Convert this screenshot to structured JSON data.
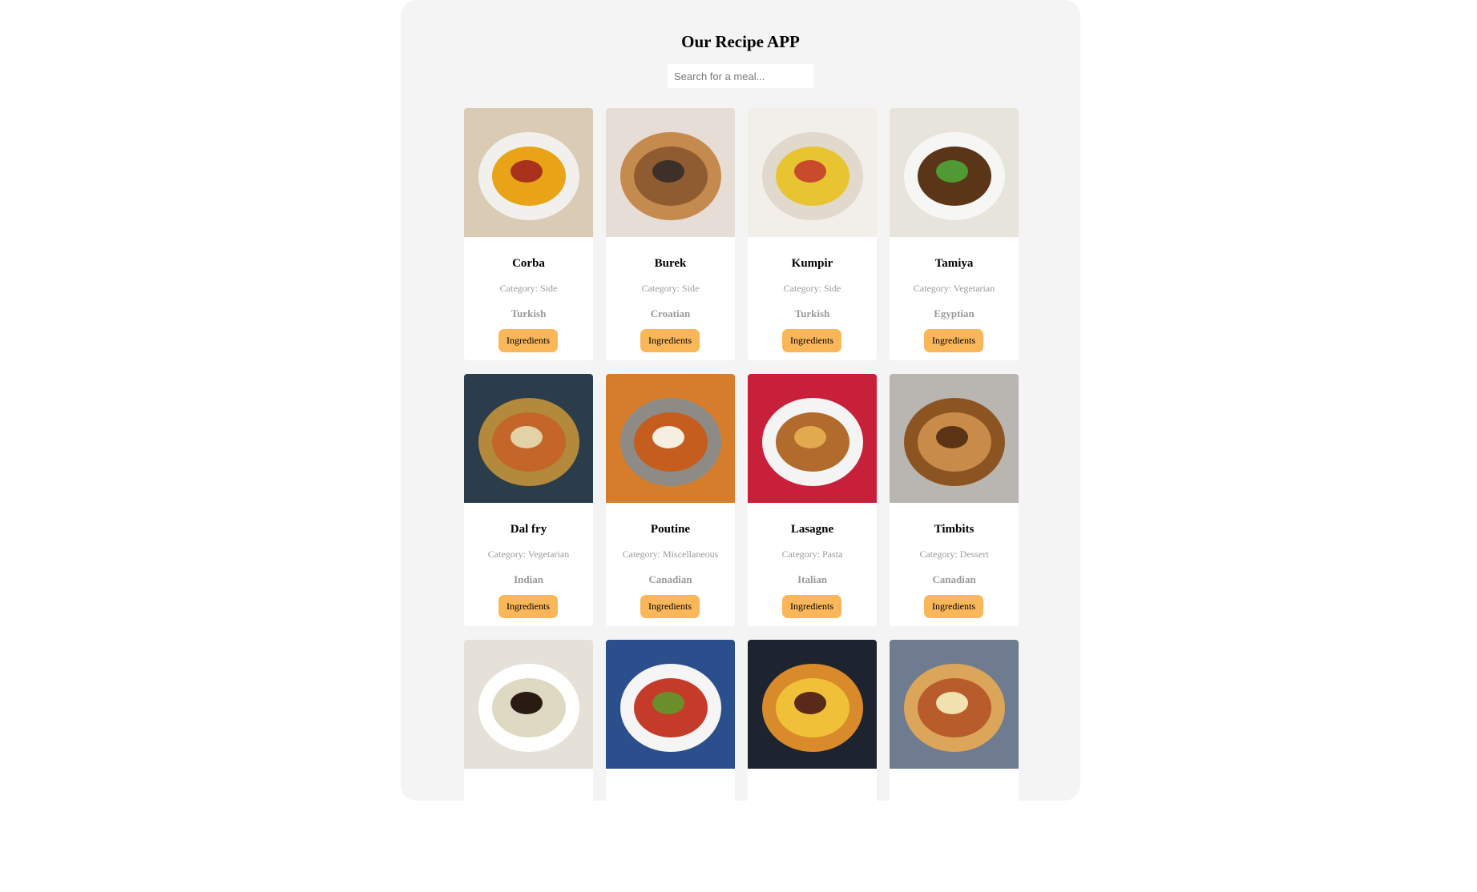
{
  "app": {
    "title": "Our Recipe APP",
    "search_placeholder": "Search for a meal...",
    "search_value": ""
  },
  "meals": [
    {
      "name": "Corba",
      "category": "Category: Side",
      "area": "Turkish",
      "button": "Ingredients",
      "image_icon": "lentil-soup-image",
      "colors": {
        "bg": "#d9cbb4",
        "main": "#f2f0ec",
        "accent": "#e8a317",
        "detail": "#a8321c"
      }
    },
    {
      "name": "Burek",
      "category": "Category: Side",
      "area": "Croatian",
      "button": "Ingredients",
      "image_icon": "burek-pastry-image",
      "colors": {
        "bg": "#e6ddd7",
        "main": "#c48a4e",
        "accent": "#8f5c31",
        "detail": "#3d3028"
      }
    },
    {
      "name": "Kumpir",
      "category": "Category: Side",
      "area": "Turkish",
      "button": "Ingredients",
      "image_icon": "stuffed-potato-image",
      "colors": {
        "bg": "#f2efea",
        "main": "#e0d9cc",
        "accent": "#e8c430",
        "detail": "#c84b2b"
      }
    },
    {
      "name": "Tamiya",
      "category": "Category: Vegetarian",
      "area": "Egyptian",
      "button": "Ingredients",
      "image_icon": "falafel-image",
      "colors": {
        "bg": "#e7e4dc",
        "main": "#f6f6f4",
        "accent": "#5a3517",
        "detail": "#4f9a35"
      }
    },
    {
      "name": "Dal fry",
      "category": "Category: Vegetarian",
      "area": "Indian",
      "button": "Ingredients",
      "image_icon": "dal-fry-image",
      "colors": {
        "bg": "#2b3d4a",
        "main": "#b38a3c",
        "accent": "#c4652a",
        "detail": "#e3d2a6"
      }
    },
    {
      "name": "Poutine",
      "category": "Category: Miscellaneous",
      "area": "Canadian",
      "button": "Ingredients",
      "image_icon": "poutine-image",
      "colors": {
        "bg": "#d67d2c",
        "main": "#8e8a86",
        "accent": "#c55d1e",
        "detail": "#f4efe1"
      }
    },
    {
      "name": "Lasagne",
      "category": "Category: Pasta",
      "area": "Italian",
      "button": "Ingredients",
      "image_icon": "lasagne-image",
      "colors": {
        "bg": "#c8203a",
        "main": "#f4f4f4",
        "accent": "#b16b2c",
        "detail": "#e2aa4e"
      }
    },
    {
      "name": "Timbits",
      "category": "Category: Dessert",
      "area": "Canadian",
      "button": "Ingredients",
      "image_icon": "timbits-image",
      "colors": {
        "bg": "#b9b5b0",
        "main": "#8c5421",
        "accent": "#c98b4a",
        "detail": "#5a3414"
      }
    },
    {
      "name": "",
      "category": "",
      "area": "",
      "button": "",
      "image_icon": "dumplings-image",
      "colors": {
        "bg": "#e6e1d8",
        "main": "#ffffff",
        "accent": "#ddd9c3",
        "detail": "#2a1a14"
      }
    },
    {
      "name": "",
      "category": "",
      "area": "",
      "button": "",
      "image_icon": "salad-bowl-image",
      "colors": {
        "bg": "#2a4f8c",
        "main": "#f5f5f5",
        "accent": "#c43b2a",
        "detail": "#6b8e2a"
      }
    },
    {
      "name": "",
      "category": "",
      "area": "",
      "button": "",
      "image_icon": "burger-image",
      "colors": {
        "bg": "#1e2330",
        "main": "#d98a2a",
        "accent": "#f0c038",
        "detail": "#5a2a18"
      }
    },
    {
      "name": "",
      "category": "",
      "area": "",
      "button": "",
      "image_icon": "koshari-image",
      "colors": {
        "bg": "#6f7c90",
        "main": "#dba65a",
        "accent": "#b95c2c",
        "detail": "#f1e2b0"
      }
    }
  ]
}
